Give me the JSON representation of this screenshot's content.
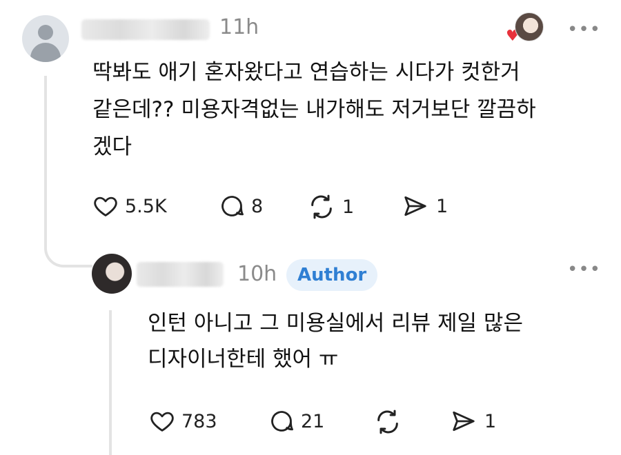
{
  "comment": {
    "time": "11h",
    "text_lines": [
      "딱봐도 애기 혼자왔다고 연습하는 시다가 컷한거",
      "같은데?? 미용자격없는 내가해도 저거보단 깔끔하",
      "겠다"
    ],
    "more": "•••",
    "likes": "5.5K",
    "replies": "8",
    "reposts": "1",
    "shares": "1"
  },
  "reply": {
    "time": "10h",
    "badge": "Author",
    "text_lines": [
      "인턴 아니고 그 미용실에서 리뷰 제일 많은",
      "디자이너한테 했어 ㅠ"
    ],
    "more": "•••",
    "likes": "783",
    "replies": "21",
    "shares": "1"
  },
  "icons": [
    "heart-icon",
    "comment-icon",
    "repost-icon",
    "share-icon",
    "more-icon"
  ],
  "colors": {
    "author_badge_bg": "#e7f1fb",
    "author_badge_text": "#2f7fd3",
    "liked_heart": "#e8323c"
  }
}
